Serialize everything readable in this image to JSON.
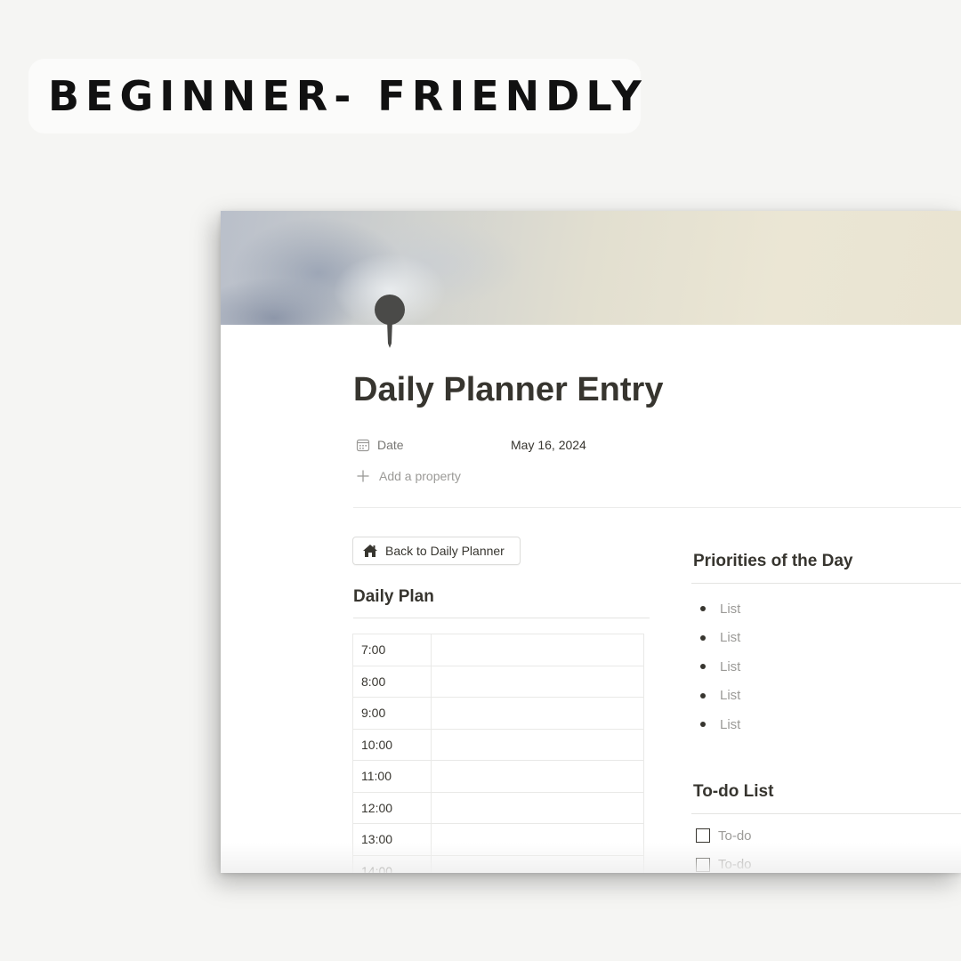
{
  "badge": {
    "text": "BEGINNER- FRIENDLY"
  },
  "page": {
    "title": "Daily Planner Entry",
    "icon": "pushpin-icon",
    "cover": "sky-clouds-image"
  },
  "properties": [
    {
      "icon": "calendar-icon",
      "name": "Date",
      "value": "May 16, 2024"
    }
  ],
  "add_property": {
    "icon": "plus-icon",
    "label": "Add a property"
  },
  "back_button": {
    "icon": "home-icon",
    "label": "Back to Daily Planner"
  },
  "daily_plan": {
    "title": "Daily Plan",
    "rows": [
      "7:00",
      "8:00",
      "9:00",
      "10:00",
      "11:00",
      "12:00",
      "13:00",
      "14:00"
    ]
  },
  "priorities": {
    "title": "Priorities of the Day",
    "items": [
      "List",
      "List",
      "List",
      "List",
      "List"
    ]
  },
  "todo": {
    "title": "To-do List",
    "items": [
      "To-do",
      "To-do"
    ]
  },
  "colors": {
    "page_background": "#f5f5f3",
    "text_primary": "#37352f",
    "text_muted": "#9b9a97",
    "badge_text": "#111111"
  }
}
